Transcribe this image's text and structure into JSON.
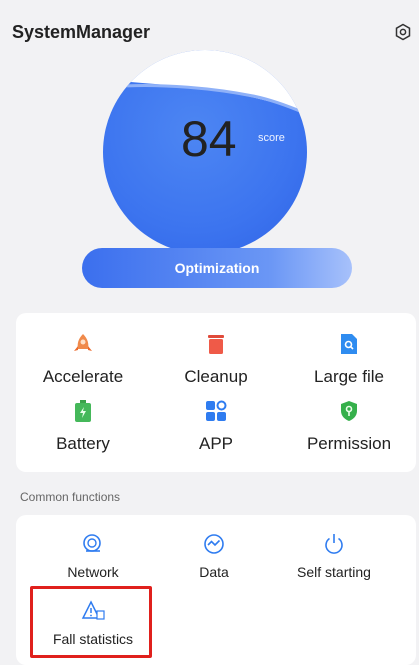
{
  "header": {
    "title": "SystemManager",
    "settings_icon": "settings-icon"
  },
  "score": {
    "value": "84",
    "unit": "score"
  },
  "optimization": {
    "label": "Optimization"
  },
  "tools": [
    {
      "label": "Accelerate",
      "icon": "rocket-icon"
    },
    {
      "label": "Cleanup",
      "icon": "trash-icon"
    },
    {
      "label": "Large file",
      "icon": "file-search-icon"
    },
    {
      "label": "Battery",
      "icon": "battery-icon"
    },
    {
      "label": "APP",
      "icon": "app-grid-icon"
    },
    {
      "label": "Permission",
      "icon": "shield-key-icon"
    }
  ],
  "common": {
    "section_title": "Common functions",
    "items": [
      {
        "label": "Network",
        "icon": "network-icon"
      },
      {
        "label": "Data",
        "icon": "data-icon"
      },
      {
        "label": "Self starting",
        "icon": "power-icon"
      },
      {
        "label": "Fall statistics",
        "icon": "warning-icon"
      }
    ]
  },
  "colors": {
    "accent": "#3c74ef",
    "highlight": "#e0201c"
  }
}
